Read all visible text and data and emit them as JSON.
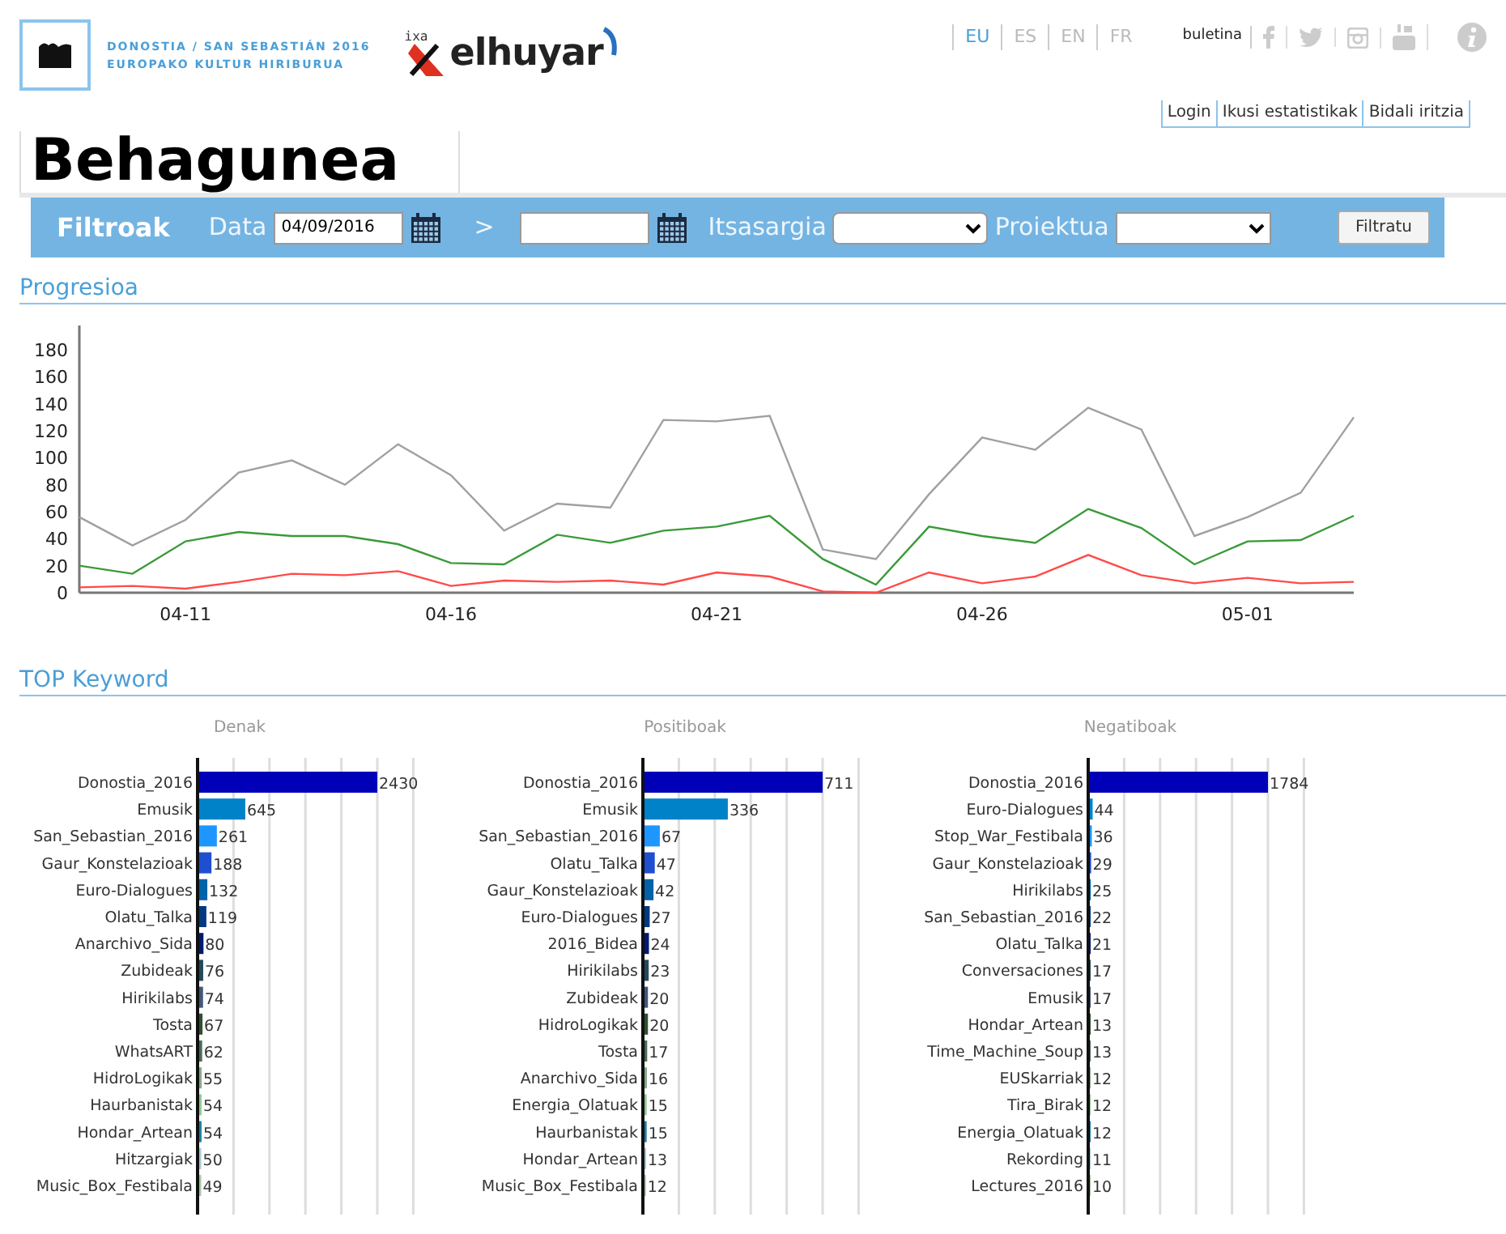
{
  "header": {
    "logo_line1": "DONOSTIA / SAN SEBASTIÁN 2016",
    "logo_line2": "EUROPAKO KULTUR HIRIBURUA",
    "partner_small": "ixa",
    "partner_name": "elhuyar"
  },
  "languages": [
    {
      "label": "EU",
      "selected": true
    },
    {
      "label": "ES",
      "selected": false
    },
    {
      "label": "EN",
      "selected": false
    },
    {
      "label": "FR",
      "selected": false
    }
  ],
  "newsletter": "buletina",
  "user_links": [
    "Login",
    "Ikusi estatistikak",
    "Bidali iritzia"
  ],
  "page_title": "Behagunea",
  "filter_bar": {
    "title": "Filtroak",
    "date_label": "Data",
    "date_from": "04/09/2016",
    "separator": ">",
    "lighthouse_label": "Itsasargia",
    "project_label": "Proiektua",
    "button": "Filtratu"
  },
  "progression": {
    "title": "Progresioa",
    "chart_data": {
      "type": "line",
      "categories": [
        null,
        null,
        "04-11",
        null,
        null,
        null,
        null,
        "04-16",
        null,
        null,
        null,
        null,
        "04-21",
        null,
        null,
        null,
        null,
        "04-26",
        null,
        null,
        null,
        null,
        "05-01",
        null,
        null
      ],
      "ylim": [
        0,
        198
      ],
      "yticks": [
        0,
        20,
        40,
        60,
        80,
        100,
        120,
        140,
        160,
        180
      ],
      "series": [
        {
          "color": "#a0a0a0",
          "values": [
            56,
            35,
            54,
            89,
            98,
            80,
            110,
            87,
            46,
            66,
            63,
            128,
            127,
            131,
            32,
            25,
            73,
            115,
            106,
            137,
            121,
            42,
            56,
            74,
            130
          ]
        },
        {
          "color": "#3a9a3a",
          "values": [
            20,
            14,
            38,
            45,
            42,
            42,
            36,
            22,
            21,
            43,
            37,
            46,
            49,
            57,
            25,
            6,
            49,
            42,
            37,
            62,
            48,
            21,
            38,
            39,
            57
          ]
        },
        {
          "color": "#ff4a4a",
          "values": [
            4,
            5,
            3,
            8,
            14,
            13,
            16,
            5,
            9,
            8,
            9,
            6,
            15,
            12,
            1,
            0,
            15,
            7,
            12,
            28,
            13,
            7,
            11,
            7,
            8
          ]
        }
      ]
    }
  },
  "top_keyword": {
    "title": "TOP Keyword",
    "charts": [
      {
        "chart_data": {
          "type": "bar",
          "orientation": "horizontal",
          "title": "Denak",
          "data_labels": true,
          "categories": [
            "Donostia_2016",
            "Emusik",
            "San_Sebastian_2016",
            "Gaur_Konstelazioak",
            "Euro-Dialogues",
            "Olatu_Talka",
            "Anarchivo_Sida",
            "Zubideak",
            "Hirikilabs",
            "Tosta",
            "WhatsART",
            "HidroLogikak",
            "Haurbanistak",
            "Hondar_Artean",
            "Hitzargiak",
            "Music_Box_Festibala"
          ],
          "values": [
            2430,
            645,
            261,
            188,
            132,
            119,
            80,
            76,
            74,
            67,
            62,
            55,
            54,
            54,
            50,
            49
          ],
          "colors": [
            "#0000b8",
            "#0082c8",
            "#1e96ff",
            "#1e4fd0",
            "#0062a8",
            "#003a80",
            "#001a70",
            "#234a5a",
            "#405878",
            "#2e5030",
            "#4a6a58",
            "#8aa888",
            "#90c890",
            "#1c7fa0",
            "#a8c8d0",
            "#a0c8a0"
          ]
        }
      },
      {
        "chart_data": {
          "type": "bar",
          "orientation": "horizontal",
          "title": "Positiboak",
          "data_labels": true,
          "categories": [
            "Donostia_2016",
            "Emusik",
            "San_Sebastian_2016",
            "Olatu_Talka",
            "Gaur_Konstelazioak",
            "Euro-Dialogues",
            "2016_Bidea",
            "Hirikilabs",
            "Zubideak",
            "HidroLogikak",
            "Tosta",
            "Anarchivo_Sida",
            "Energia_Olatuak",
            "Haurbanistak",
            "Hondar_Artean",
            "Music_Box_Festibala"
          ],
          "values": [
            711,
            336,
            67,
            47,
            42,
            27,
            24,
            23,
            20,
            20,
            17,
            16,
            15,
            15,
            13,
            12
          ],
          "colors": [
            "#0000b8",
            "#0082c8",
            "#1e96ff",
            "#1e4fd0",
            "#0062a8",
            "#003a80",
            "#001a70",
            "#234a5a",
            "#405878",
            "#2e5030",
            "#4a6a58",
            "#8aa888",
            "#90c890",
            "#1c7fa0",
            "#a8c8d0",
            "#a0c8a0"
          ]
        }
      },
      {
        "chart_data": {
          "type": "bar",
          "orientation": "horizontal",
          "title": "Negatiboak",
          "data_labels": true,
          "categories": [
            "Donostia_2016",
            "Euro-Dialogues",
            "Stop_War_Festibala",
            "Gaur_Konstelazioak",
            "Hirikilabs",
            "San_Sebastian_2016",
            "Olatu_Talka",
            "Conversaciones",
            "Emusik",
            "Hondar_Artean",
            "Time_Machine_Soup",
            "EUSkarriak",
            "Tira_Birak",
            "Energia_Olatuak",
            "Rekording",
            "Lectures_2016"
          ],
          "values": [
            1784,
            44,
            36,
            29,
            25,
            22,
            21,
            17,
            17,
            13,
            13,
            12,
            12,
            12,
            11,
            10
          ],
          "colors": [
            "#0000b8",
            "#0082c8",
            "#1e96ff",
            "#1e4fd0",
            "#0062a8",
            "#003a80",
            "#001a70",
            "#234a5a",
            "#405878",
            "#2e5030",
            "#4a6a58",
            "#8aa888",
            "#90c890",
            "#1c7fa0",
            "#a8c8d0",
            "#a0c8a0"
          ]
        }
      }
    ]
  }
}
